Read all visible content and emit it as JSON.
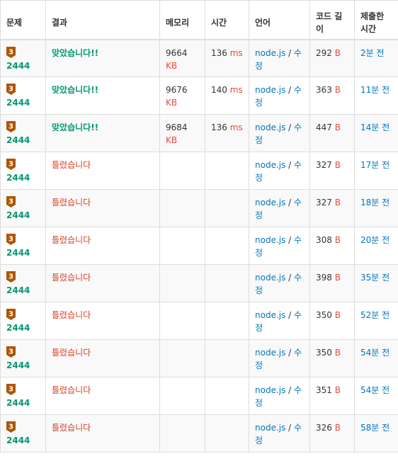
{
  "colors": {
    "problem_link": "#009874",
    "accepted": "#009874",
    "wrong_answer": "#dd4124",
    "unit": "#e74c3c",
    "link": "#0076c0",
    "tier_bronze": "#ad5600"
  },
  "headers": {
    "problem": "문제",
    "result": "결과",
    "memory": "메모리",
    "time": "시간",
    "language": "언어",
    "code_length": "코드 길이",
    "submitted": "제출한 시간"
  },
  "rows": [
    {
      "tier": "3",
      "problem": "2444",
      "result": "맞았습니다!!",
      "status": "ac",
      "memory": "9664",
      "memory_unit": "KB",
      "time": "136",
      "time_unit": "ms",
      "language": "node.js",
      "sep": " / ",
      "edit": "수정",
      "length": "292",
      "length_unit": "B",
      "submitted": "2분 전"
    },
    {
      "tier": "3",
      "problem": "2444",
      "result": "맞았습니다!!",
      "status": "ac",
      "memory": "9676",
      "memory_unit": "KB",
      "time": "140",
      "time_unit": "ms",
      "language": "node.js",
      "sep": " / ",
      "edit": "수정",
      "length": "363",
      "length_unit": "B",
      "submitted": "11분 전"
    },
    {
      "tier": "3",
      "problem": "2444",
      "result": "맞았습니다!!",
      "status": "ac",
      "memory": "9684",
      "memory_unit": "KB",
      "time": "136",
      "time_unit": "ms",
      "language": "node.js",
      "sep": " / ",
      "edit": "수정",
      "length": "447",
      "length_unit": "B",
      "submitted": "14분 전"
    },
    {
      "tier": "3",
      "problem": "2444",
      "result": "틀렸습니다",
      "status": "wa",
      "memory": "",
      "memory_unit": "",
      "time": "",
      "time_unit": "",
      "language": "node.js",
      "sep": " / ",
      "edit": "수정",
      "length": "327",
      "length_unit": "B",
      "submitted": "17분 전"
    },
    {
      "tier": "3",
      "problem": "2444",
      "result": "틀렸습니다",
      "status": "wa",
      "memory": "",
      "memory_unit": "",
      "time": "",
      "time_unit": "",
      "language": "node.js",
      "sep": " / ",
      "edit": "수정",
      "length": "327",
      "length_unit": "B",
      "submitted": "18분 전"
    },
    {
      "tier": "3",
      "problem": "2444",
      "result": "틀렸습니다",
      "status": "wa",
      "memory": "",
      "memory_unit": "",
      "time": "",
      "time_unit": "",
      "language": "node.js",
      "sep": " / ",
      "edit": "수정",
      "length": "308",
      "length_unit": "B",
      "submitted": "20분 전"
    },
    {
      "tier": "3",
      "problem": "2444",
      "result": "틀렸습니다",
      "status": "wa",
      "memory": "",
      "memory_unit": "",
      "time": "",
      "time_unit": "",
      "language": "node.js",
      "sep": " / ",
      "edit": "수정",
      "length": "398",
      "length_unit": "B",
      "submitted": "35분 전"
    },
    {
      "tier": "3",
      "problem": "2444",
      "result": "틀렸습니다",
      "status": "wa",
      "memory": "",
      "memory_unit": "",
      "time": "",
      "time_unit": "",
      "language": "node.js",
      "sep": " / ",
      "edit": "수정",
      "length": "350",
      "length_unit": "B",
      "submitted": "52분 전"
    },
    {
      "tier": "3",
      "problem": "2444",
      "result": "틀렸습니다",
      "status": "wa",
      "memory": "",
      "memory_unit": "",
      "time": "",
      "time_unit": "",
      "language": "node.js",
      "sep": " / ",
      "edit": "수정",
      "length": "350",
      "length_unit": "B",
      "submitted": "54분 전"
    },
    {
      "tier": "3",
      "problem": "2444",
      "result": "틀렸습니다",
      "status": "wa",
      "memory": "",
      "memory_unit": "",
      "time": "",
      "time_unit": "",
      "language": "node.js",
      "sep": " / ",
      "edit": "수정",
      "length": "351",
      "length_unit": "B",
      "submitted": "54분 전"
    },
    {
      "tier": "3",
      "problem": "2444",
      "result": "틀렸습니다",
      "status": "wa",
      "memory": "",
      "memory_unit": "",
      "time": "",
      "time_unit": "",
      "language": "node.js",
      "sep": " / ",
      "edit": "수정",
      "length": "326",
      "length_unit": "B",
      "submitted": "58분 전"
    }
  ]
}
